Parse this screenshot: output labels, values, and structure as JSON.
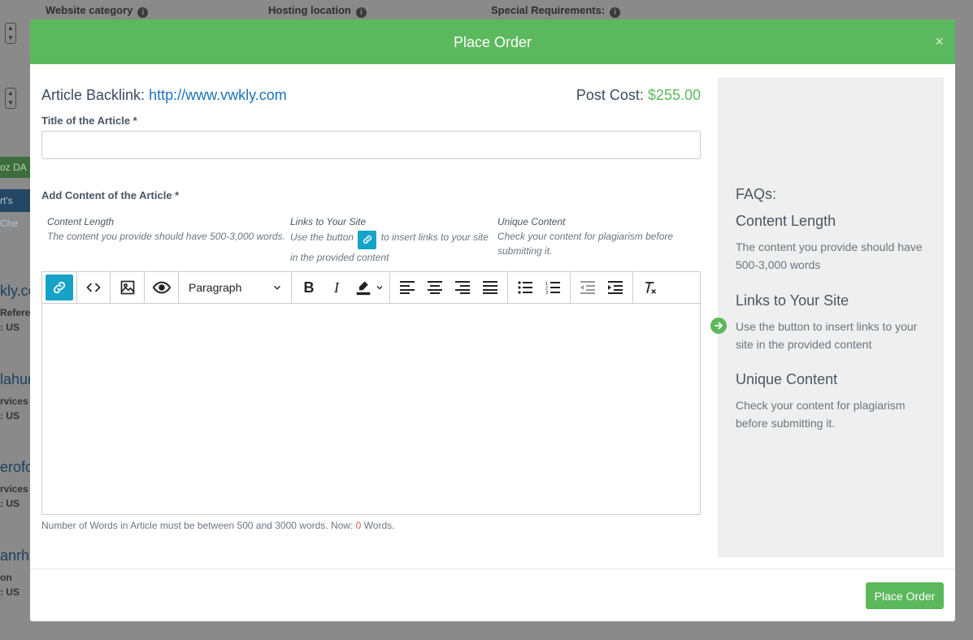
{
  "background": {
    "col1": "Website category",
    "col2": "Hosting location",
    "col3": "Special Requirements:",
    "green_btn": "oz DA",
    "blue_btn": "rt's Che",
    "rows": [
      {
        "title": "kly.co",
        "line1": "Referer",
        "line2": ": US"
      },
      {
        "title": "lahur",
        "line1": "rvices",
        "line2": ": US"
      },
      {
        "title": "erofoc",
        "line1": "rvices",
        "line2": ": US"
      },
      {
        "title": "anrha",
        "line1": "on",
        "line2": ": US"
      }
    ]
  },
  "modal": {
    "title": "Place Order",
    "close": "×",
    "backlink_label": "Article Backlink:",
    "backlink_url": "http://www.vwkly.com",
    "cost_label": "Post Cost:",
    "cost_value": "$255.00",
    "title_label": "Title of the Article *",
    "title_value": "",
    "content_label": "Add Content of the Article *",
    "tips": {
      "length_head": "Content Length",
      "length_text": "The content you provide should have 500-3,000 words.",
      "links_head": "Links to Your Site",
      "links_text_a": "Use the button",
      "links_text_b": "to insert links to your site",
      "links_text_c": "in the provided content",
      "unique_head": "Unique Content",
      "unique_text_a": "Check your content for plagiarism before",
      "unique_text_b": "submitting it."
    },
    "toolbar": {
      "format": "Paragraph"
    },
    "wordcount": {
      "pre": "Number of Words in Article must be between 500 and 3000 words. Now: ",
      "count": "0",
      "post": " Words."
    },
    "faq": {
      "title": "FAQs:",
      "items": [
        {
          "head": "Content Length",
          "text": "The content you provide should have 500-3,000 words"
        },
        {
          "head": "Links to Your Site",
          "text": "Use the button to insert links to your site in the provided content"
        },
        {
          "head": "Unique Content",
          "text": "Check your content for plagiarism before submitting it."
        }
      ]
    },
    "submit": "Place Order"
  },
  "colors": {
    "green": "#5cb85c",
    "link": "#1a73b8",
    "accent": "#17a2c7",
    "red": "#e05a4f"
  },
  "icons": [
    "info-icon",
    "link-icon",
    "code-icon",
    "image-icon",
    "preview-icon",
    "chevron-down-icon",
    "bold-icon",
    "italic-icon",
    "highlight-icon",
    "align-left-icon",
    "align-center-icon",
    "align-right-icon",
    "align-justify-icon",
    "bullet-list-icon",
    "numbered-list-icon",
    "outdent-icon",
    "indent-icon",
    "clear-format-icon",
    "arrow-right-circle-icon"
  ]
}
